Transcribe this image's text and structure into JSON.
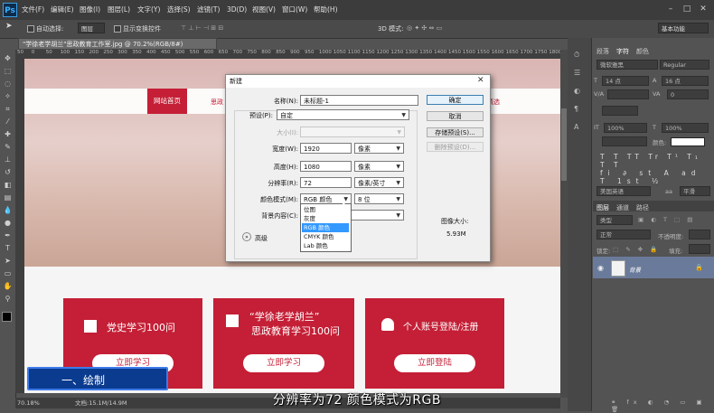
{
  "app": {
    "logo": "Ps",
    "workspace": "基本功能"
  },
  "menu": [
    "文件(F)",
    "编辑(E)",
    "图像(I)",
    "图层(L)",
    "文字(Y)",
    "选择(S)",
    "滤镜(T)",
    "3D(D)",
    "视图(V)",
    "窗口(W)",
    "帮助(H)"
  ],
  "window_controls": [
    "–",
    "□",
    "✕"
  ],
  "options_bar": {
    "auto_select_label": "自动选择:",
    "auto_select_value": "图层",
    "show_transform_label": "显示变换控件",
    "mode_3d_label": "3D 模式:"
  },
  "document_tab": "\"学徐老学胡兰\"思政教育工作室.jpg @ 70.2%(RGB/8#)",
  "ruler_ticks": [
    "50",
    "0",
    "50",
    "100",
    "150",
    "200",
    "250",
    "300",
    "350",
    "400",
    "450",
    "500",
    "550",
    "600",
    "650",
    "700",
    "750",
    "800",
    "850",
    "900",
    "950",
    "1000",
    "1050",
    "1100",
    "1150",
    "1200",
    "1250",
    "1300",
    "1350",
    "1400",
    "1450",
    "1500",
    "1550",
    "1600",
    "1650",
    "1700",
    "1750",
    "1800"
  ],
  "status": {
    "zoom": "70.18%",
    "doc_size": "文档:15.1M/14.9M"
  },
  "website": {
    "nav_home": "网站首页",
    "nav_item2": "思政",
    "nav_item_last": "精选",
    "cards": [
      {
        "title": "党史学习100问",
        "button": "立即学习"
      },
      {
        "title_line1": "“学徐老学胡兰”",
        "title_line2": "思政教育学习100问",
        "button": "立即学习"
      },
      {
        "title": "个人账号登陆/注册",
        "button": "立即登陆"
      }
    ]
  },
  "overlay": {
    "section_tag": "一、绘制",
    "subtitle": "分辨率为72  颜色模式为RGB"
  },
  "right_panel": {
    "tabs": [
      "段落",
      "字符",
      "颜色"
    ],
    "font_family": "微软雅黑",
    "font_style": "Regular",
    "size1": "14 点",
    "size2": "16 点",
    "tracking": "0",
    "scale1": "100%",
    "scale2": "100%",
    "color_label": "颜色:",
    "language": "美国英语",
    "aa": "aa",
    "aa_value": "平滑",
    "layer_tabs": [
      "图层",
      "通道",
      "路径"
    ],
    "kind_label": "类型",
    "blend_mode": "正常",
    "opacity_label": "不透明度:",
    "lock_label": "锁定:",
    "fill_label": "填充:",
    "layer_name": "背景"
  },
  "dialog": {
    "title": "新建",
    "name_label": "名称(N):",
    "name_value": "未标题-1",
    "preset_label": "预设(P):",
    "preset_value": "自定",
    "size_label": "大小(I):",
    "width_label": "宽度(W):",
    "width_value": "1920",
    "width_unit": "像素",
    "height_label": "高度(H):",
    "height_value": "1080",
    "height_unit": "像素",
    "resolution_label": "分辨率(R):",
    "resolution_value": "72",
    "resolution_unit": "像素/英寸",
    "color_mode_label": "颜色模式(M):",
    "color_mode_value": "RGB 颜色",
    "bit_depth": "8 位",
    "bg_label": "背景内容(C):",
    "advanced_label": "高级",
    "image_size_label": "图像大小:",
    "image_size_value": "5.93M",
    "buttons": {
      "ok": "确定",
      "cancel": "取消",
      "save_preset": "存储预设(S)...",
      "delete_preset": "删除预设(D)..."
    },
    "color_mode_options": [
      "位图",
      "灰度",
      "RGB 颜色",
      "CMYK 颜色",
      "Lab 颜色"
    ]
  },
  "colors": {
    "accent": "#c41f36",
    "dialog_bg": "#f0f0f0",
    "panel_bg": "#535353",
    "highlight": "#3399ff"
  }
}
